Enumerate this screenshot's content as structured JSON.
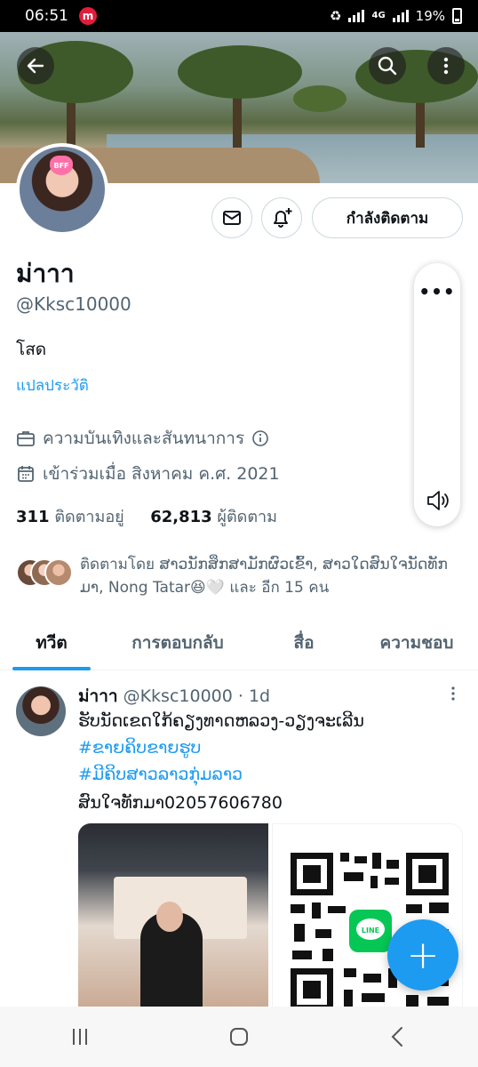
{
  "status_bar": {
    "time": "06:51",
    "app_badge": "m",
    "network": "4G",
    "battery": "19%"
  },
  "profile": {
    "display_name": "ม่าาา",
    "handle": "@Kksc10000",
    "bio": "โสด",
    "translate_link": "แปลประวัติ",
    "category": "ความบันเทิงและสันทนาการ",
    "joined": "เข้าร่วมเมื่อ สิงหาคม ค.ศ. 2021",
    "following_count": "311",
    "following_label": "ติดตามอยู่",
    "followers_count": "62,813",
    "followers_label": "ผู้ติดตาม",
    "follow_button_label": "กำลังติดตาม",
    "avatar_text": "BFF",
    "followed_by_text": "ติดตามโดย ສາວນັກສຶກສາມັກຜົວເຂົ້າ, ສາວໃດສົນໃຈນັດທັກມາ, Nong Tatar😆🤍 และ อีก 15 คน"
  },
  "tabs": [
    {
      "label": "ทวีต",
      "active": true
    },
    {
      "label": "การตอบกลับ",
      "active": false
    },
    {
      "label": "สื่อ",
      "active": false
    },
    {
      "label": "ความชอบ",
      "active": false
    }
  ],
  "tweet": {
    "author": "ม่าาา",
    "handle": "@Kksc10000",
    "time": "· 1d",
    "line1": "ຮັບນັດເຂດໃກ້ຄຽງທາດຫລວງ-ວຽງຈະເລີນ",
    "hashtag1": "#ຂາຍຄິບຂາຍຮູບ",
    "hashtag2": "#ມີຄິບສາວລາວກຸ່ມລາວ",
    "line2": "ສົນໃຈທັກມາ02057606780",
    "qr_badge": "LINE"
  },
  "fab_label": "+",
  "colors": {
    "accent": "#1d9bf0",
    "text": "#0f1419",
    "secondary": "#536471",
    "border": "#cfd9de"
  }
}
